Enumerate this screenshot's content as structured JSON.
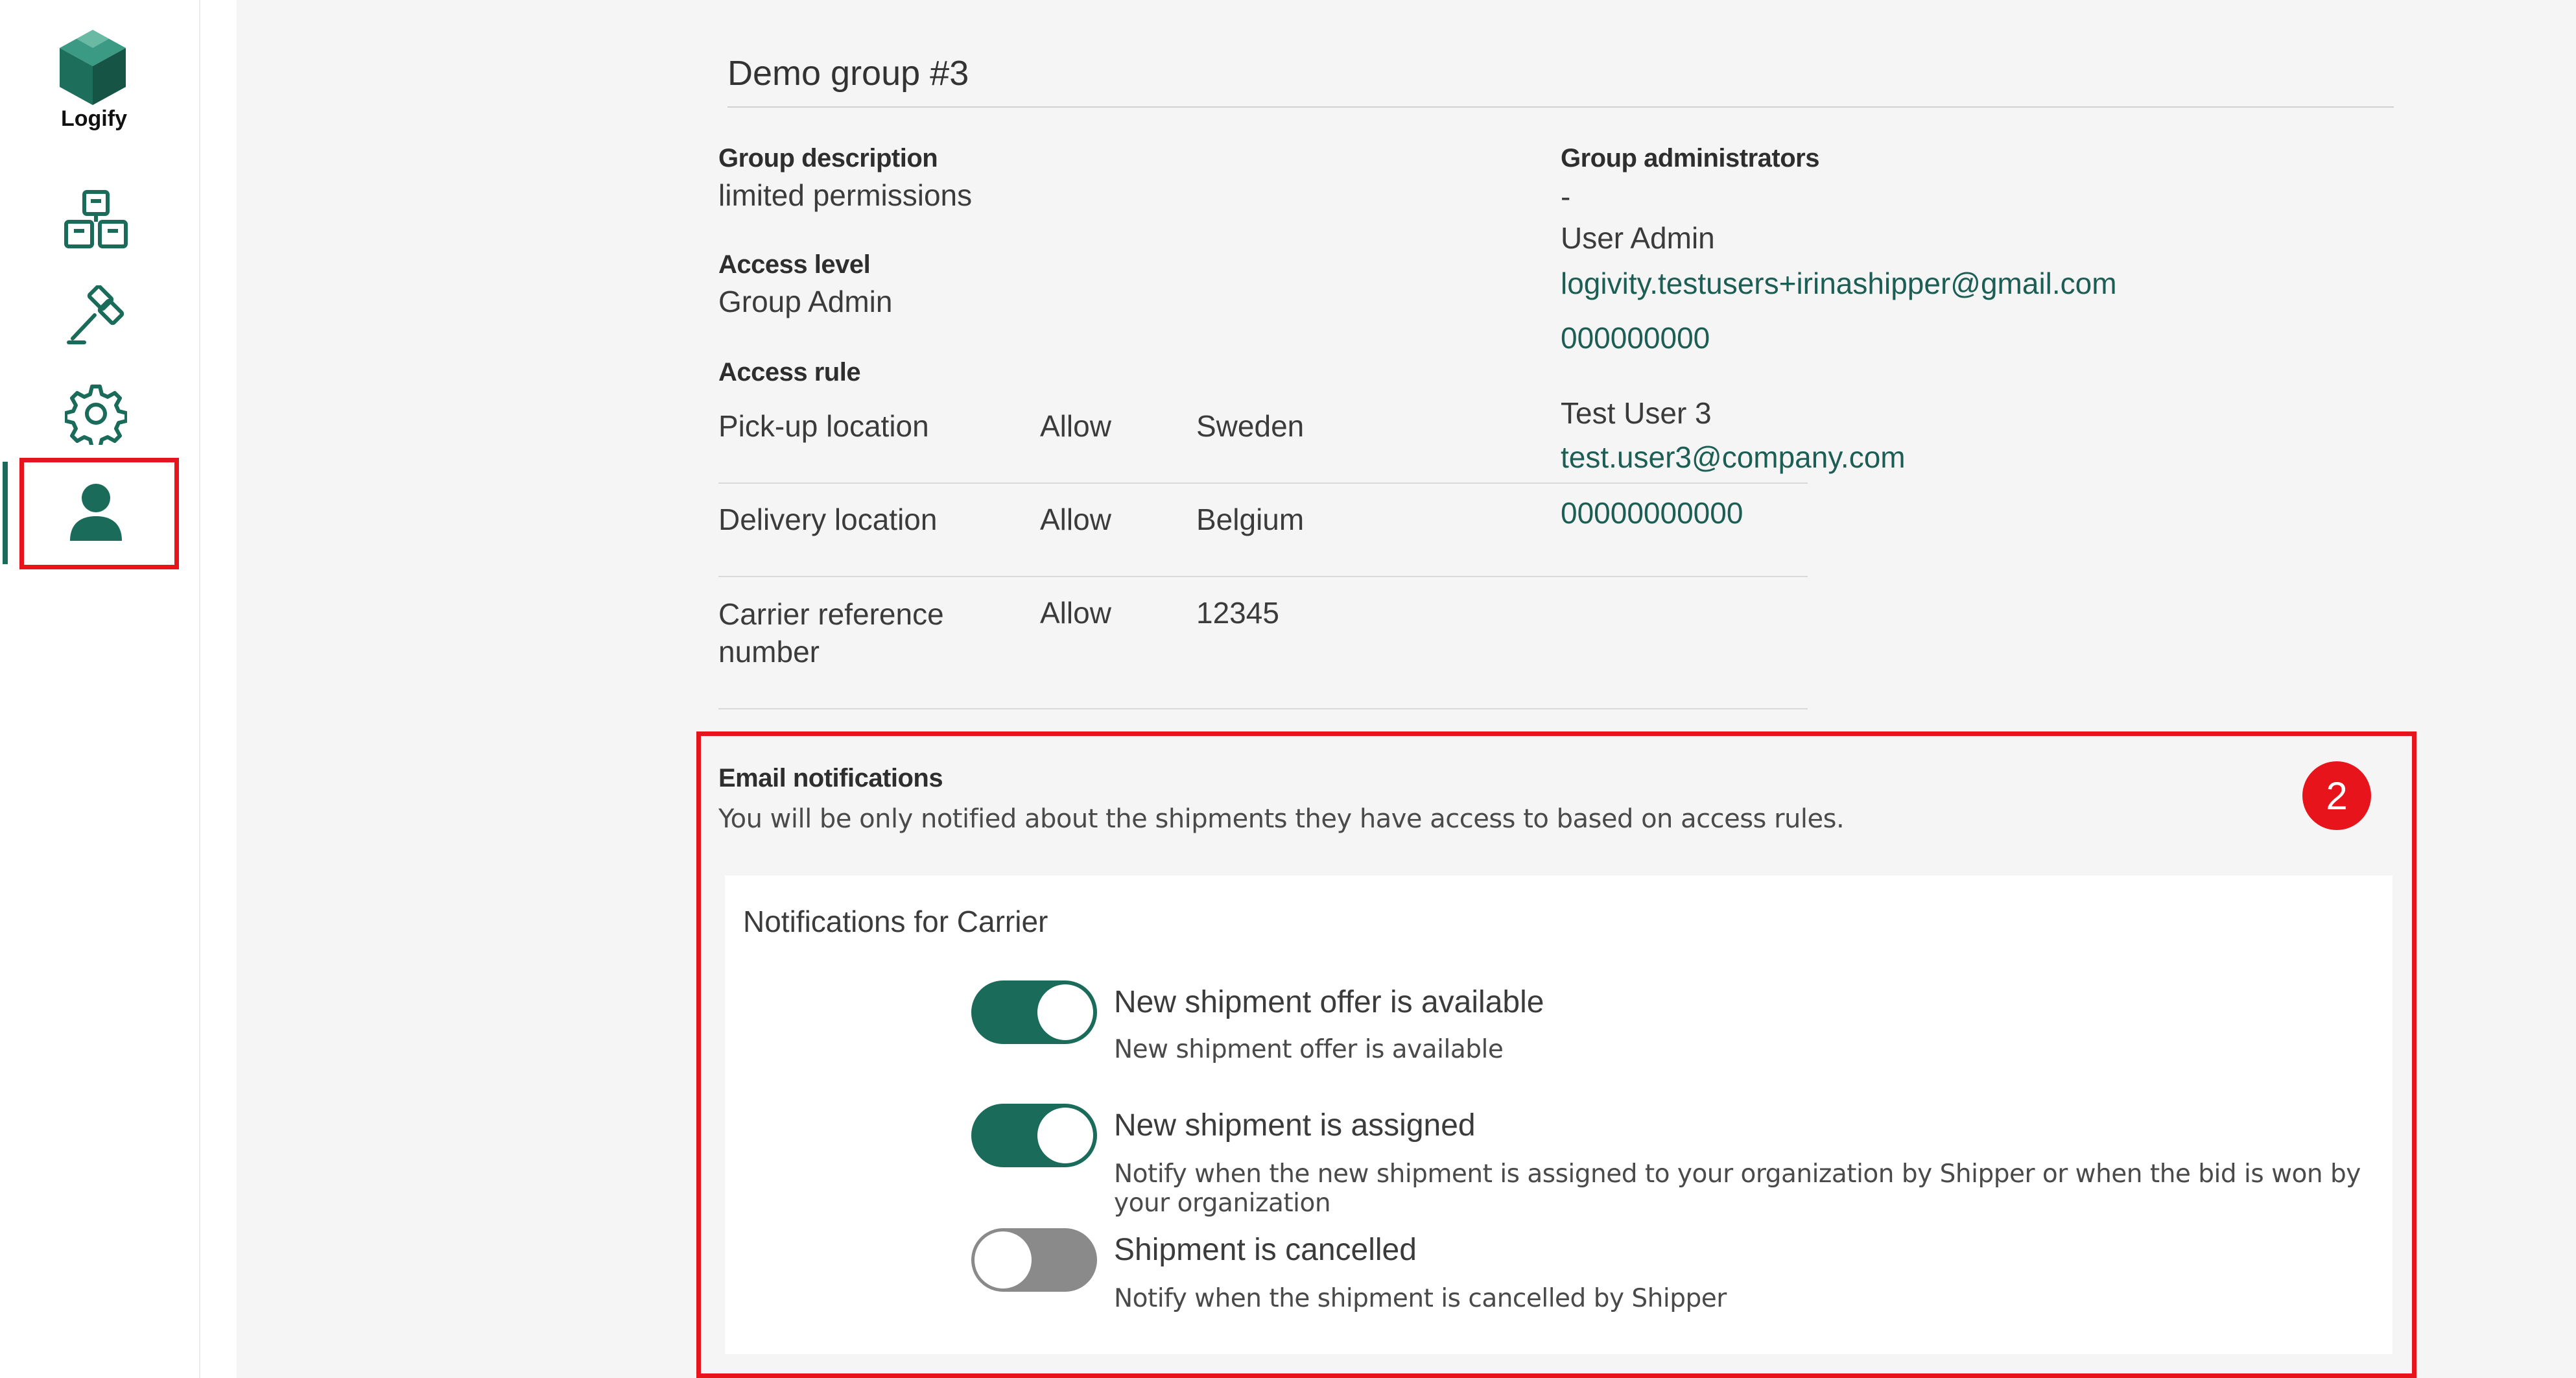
{
  "sidebar": {
    "logo_text": "Logify",
    "items": [
      {
        "icon": "boxes-icon"
      },
      {
        "icon": "gavel-icon"
      },
      {
        "icon": "gear-icon"
      },
      {
        "icon": "user-icon",
        "active": true
      }
    ],
    "accent": "#1b6b5a"
  },
  "group": {
    "title": "Demo group #3",
    "description_label": "Group description",
    "description": "limited permissions",
    "access_level_label": "Access level",
    "access_level": "Group Admin",
    "access_rule_label": "Access rule",
    "rules": [
      {
        "field": "Pick-up location",
        "mode": "Allow",
        "value": "Sweden"
      },
      {
        "field": "Delivery location",
        "mode": "Allow",
        "value": "Belgium"
      },
      {
        "field": "Carrier reference number",
        "mode": "Allow",
        "value": "12345"
      }
    ],
    "admins_label": "Group administrators",
    "admins_dash": "-",
    "admins": [
      {
        "name": "User Admin",
        "email": "logivity.testusers+irinashipper@gmail.com",
        "phone": "000000000"
      },
      {
        "name": "Test User 3",
        "email": "test.user3@company.com",
        "phone": "00000000000"
      }
    ]
  },
  "email": {
    "label": "Email notifications",
    "note": "You will be only notified about the shipments they have access to based on access rules.",
    "section_title": "Notifications for Carrier",
    "badge": "2",
    "items": [
      {
        "title": "New shipment offer is available",
        "desc": "New shipment offer is available",
        "enabled": true
      },
      {
        "title": "New shipment is assigned",
        "desc": "Notify when the new shipment is assigned to your organization by Shipper or when the bid is won by your organization",
        "enabled": true
      },
      {
        "title": "Shipment is cancelled",
        "desc": "Notify when the shipment is cancelled by Shipper",
        "enabled": false
      }
    ]
  }
}
